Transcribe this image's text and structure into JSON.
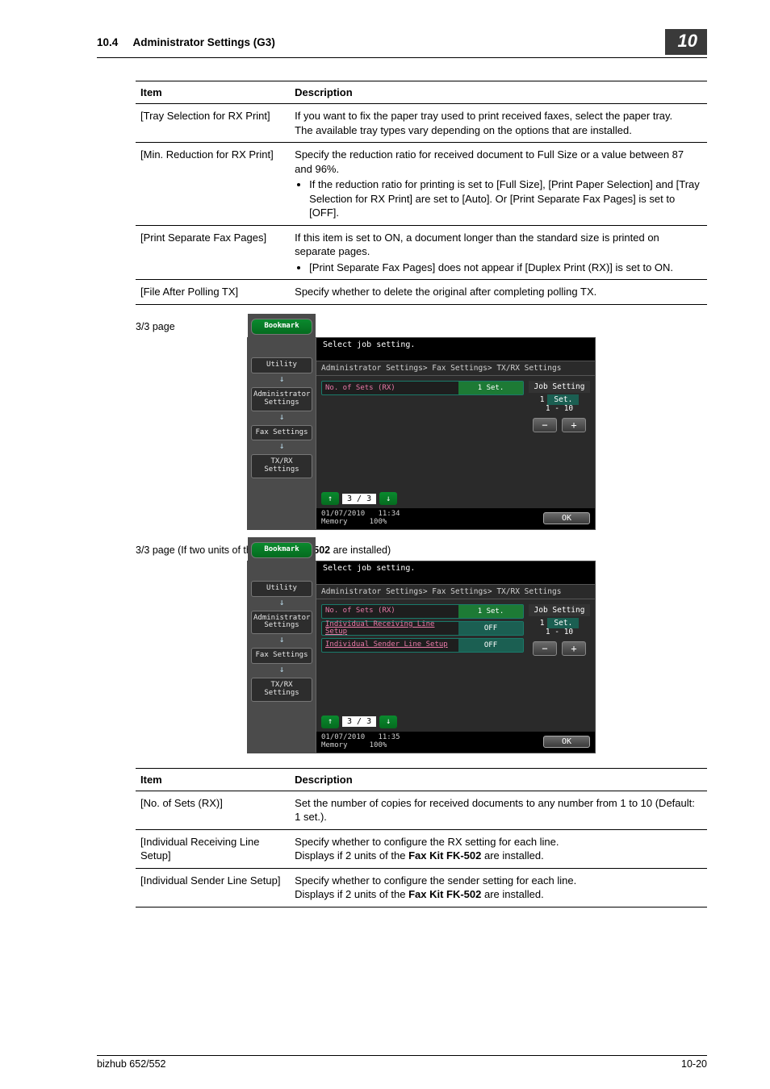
{
  "header": {
    "section_number": "10.4",
    "section_title": "Administrator Settings (G3)",
    "chapter_badge": "10"
  },
  "table1": {
    "head_item": "Item",
    "head_desc": "Description",
    "rows": [
      {
        "item": "[Tray Selection for RX Print]",
        "desc_lines": [
          "If you want to fix the paper tray used to print received faxes, select the paper tray.",
          "The available tray types vary depending on the options that are installed."
        ],
        "bullets": []
      },
      {
        "item": "[Min. Reduction for RX Print]",
        "desc_lines": [
          "Specify the reduction ratio for received document to Full Size or a value between 87 and 96%."
        ],
        "bullets": [
          "If the reduction ratio for printing is set to [Full Size], [Print Paper Selection] and [Tray Selection for RX Print] are set to [Auto]. Or [Print Separate Fax Pages] is set to [OFF]."
        ]
      },
      {
        "item": "[Print Separate Fax Pages]",
        "desc_lines": [
          "If this item is set to ON, a document longer than the standard size is printed on separate pages."
        ],
        "bullets": [
          "[Print Separate Fax Pages] does not appear if [Duplex Print (RX)] is set to ON."
        ]
      },
      {
        "item": "[File After Polling TX]",
        "desc_lines": [
          "Specify whether to delete the original after completing polling TX."
        ],
        "bullets": []
      }
    ]
  },
  "caption1": "3/3 page",
  "device_common": {
    "top_instruction": "Select job setting.",
    "bookmark": "Bookmark",
    "side_buttons": [
      "Utility",
      "Administrator Settings",
      "Fax Settings",
      "TX/RX Settings"
    ],
    "breadcrumb": "Administrator Settings> Fax Settings> TX/RX Settings",
    "job_setting_label": "Job Setting",
    "pager_text": "3 / 3",
    "ok": "OK",
    "memory": "Memory",
    "mem_pct": "100%"
  },
  "device1": {
    "rows": [
      {
        "label": "No. of Sets (RX)",
        "value": "1  Set."
      }
    ],
    "right_val_top": "1",
    "right_val_unit": "Set.",
    "right_range": "1  -  10",
    "timestamp": "01/07/2010   11:34"
  },
  "caption2_pre": "3/3 page (If two units of the ",
  "caption2_bold": "Fax Kit FK-502",
  "caption2_post": " are installed)",
  "device2": {
    "rows": [
      {
        "label": "No. of Sets (RX)",
        "value": "1  Set."
      },
      {
        "label": "Individual Receiving Line Setup",
        "value": "OFF"
      },
      {
        "label": "Individual Sender Line Setup",
        "value": "OFF"
      }
    ],
    "right_val_top": "1",
    "right_val_unit": "Set.",
    "right_range": "1  -  10",
    "timestamp": "01/07/2010   11:35"
  },
  "table2": {
    "head_item": "Item",
    "head_desc": "Description",
    "rows": [
      {
        "item": "[No. of Sets (RX)]",
        "desc_plain": "Set the number of copies for received documents to any number from 1 to 10 (Default: 1 set.)."
      },
      {
        "item": "[Individual Receiving Line Setup]",
        "desc_line1": "Specify whether to configure the RX setting for each line.",
        "desc_line2_pre": "Displays if 2 units of the ",
        "desc_line2_bold": "Fax Kit FK-502",
        "desc_line2_post": " are installed."
      },
      {
        "item": "[Individual Sender Line Setup]",
        "desc_line1": "Specify whether to configure the sender setting for each line.",
        "desc_line2_pre": "Displays if 2 units of the ",
        "desc_line2_bold": "Fax Kit FK-502",
        "desc_line2_post": " are installed."
      }
    ]
  },
  "footer": {
    "left": "bizhub 652/552",
    "right": "10-20"
  }
}
